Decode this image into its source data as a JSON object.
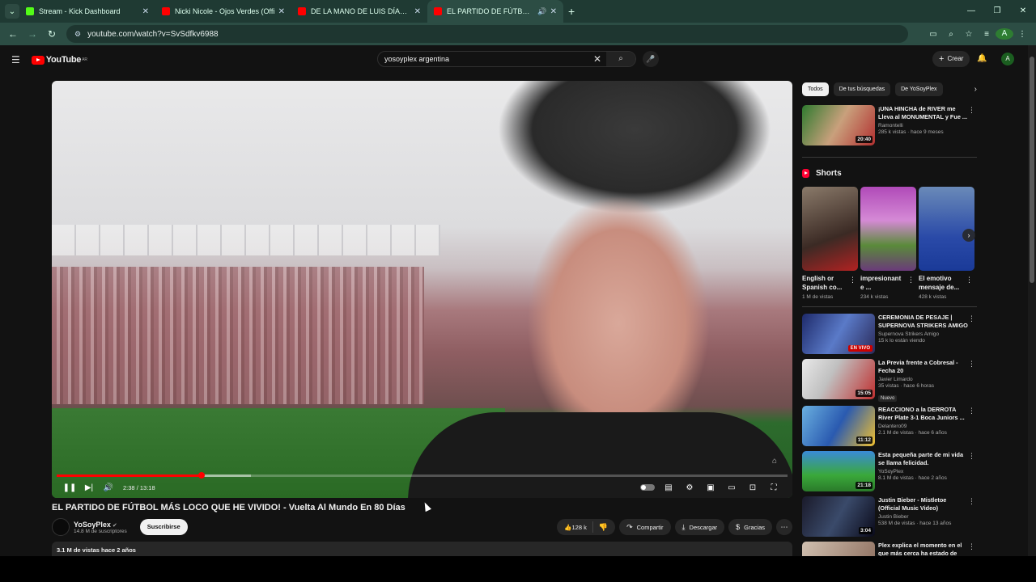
{
  "browser": {
    "tabs": [
      {
        "label": "Stream - Kick Dashboard",
        "color": "#53fc18"
      },
      {
        "label": "Nicki Nicole - Ojos Verdes (Offi",
        "color": "#ff0000"
      },
      {
        "label": "DE LA MANO DE LUIS DÍAZ, EL",
        "color": "#ff0000"
      },
      {
        "label": "EL PARTIDO DE FÚTBOL MÁ",
        "color": "#ff0000"
      }
    ],
    "url": "youtube.com/watch?v=SvSdfkv6988",
    "profile_initial": "A"
  },
  "youtube": {
    "logo_text": "YouTube",
    "country": "AR",
    "search_value": "yosoyplex argentina",
    "create_label": "Crear",
    "avatar_initial": "A"
  },
  "player": {
    "current_time": "2:38",
    "duration": "13:18",
    "progress_fraction": 0.198
  },
  "video": {
    "title": "EL PARTIDO DE FÚTBOL MÁS LOCO QUE HE VIVIDO! - Vuelta Al Mundo En 80 Días",
    "channel": "YoSoyPlex",
    "subscribers": "14.8 M de suscriptores",
    "subscribe_label": "Suscribirse",
    "likes": "128 k",
    "share_label": "Compartir",
    "download_label": "Descargar",
    "thanks_label": "Gracias",
    "views_date": "3.1 M de vistas  hace 2 años"
  },
  "sidebar": {
    "chips": [
      "Todos",
      "De tus búsquedas",
      "De YoSoyPlex"
    ],
    "top_rec": {
      "title": "¡UNA HINCHA de RIVER me Lleva al MONUMENTAL y Fue ...",
      "channel": "Ramontelli",
      "views": "285 k vistas · hace 9 meses",
      "duration": "20:40"
    },
    "shorts_title": "Shorts",
    "shorts": [
      {
        "title": "English or Spanish co...",
        "views": "1 M de vistas"
      },
      {
        "title": "impresionant e ...",
        "views": "234 k vistas"
      },
      {
        "title": "El emotivo mensaje de...",
        "views": "428 k vistas"
      }
    ],
    "recs": [
      {
        "title": "CEREMONIA DE PESAJE | SUPERNOVA STRIKERS AMIGO",
        "channel": "Supernova Strikers Amigo",
        "views": "15 k lo están viendo",
        "badge": "EN VIVO"
      },
      {
        "title": "La Previa frente a Cobresal - Fecha 20",
        "channel": "Javier Limardo",
        "views": "35 vistas · hace 6 horas",
        "duration": "15:05",
        "tag": "Nuevo"
      },
      {
        "title": "REACCIONO a la DERROTA River Plate 3-1 Boca Juniors ...",
        "channel": "Delantero09",
        "views": "2.1 M de vistas · hace 6 años",
        "duration": "11:12"
      },
      {
        "title": "Esta pequeña parte de mi vida se llama felicidad.",
        "channel": "YoSoyPlex",
        "views": "8.1 M de vistas · hace 2 años",
        "duration": "21:18"
      },
      {
        "title": "Justin Bieber - Mistletoe (Official Music Video)",
        "channel": "Justin Bieber",
        "views": "538 M de vistas · hace 13 años",
        "duration": "3:04"
      },
      {
        "title": "Plex explica el momento en el que más cerca ha estado de",
        "channel": "",
        "views": ""
      }
    ]
  }
}
